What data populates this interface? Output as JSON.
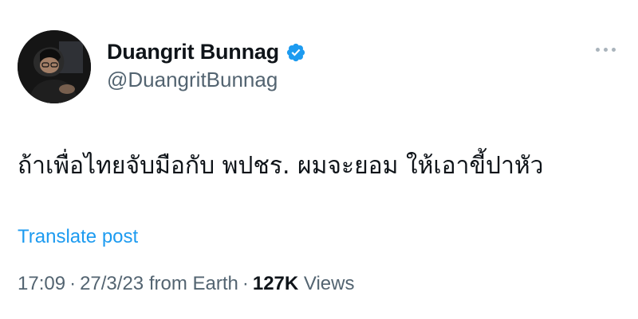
{
  "author": {
    "display_name": "Duangrit Bunnag",
    "handle": "@DuangritBunnag",
    "verified": true
  },
  "tweet": {
    "text": "ถ้าเพื่อไทยจับมือกับ พปชร. ผมจะยอม ให้เอาขี้ปาหัว",
    "translate_label": "Translate post",
    "time": "17:09",
    "date": "27/3/23",
    "source": "from Earth",
    "separator": "·",
    "views_count": "127K",
    "views_label": "Views"
  },
  "icons": {
    "verified": "verified-badge-icon",
    "more": "more-options-icon"
  },
  "colors": {
    "link": "#1d9bf0",
    "verified": "#1d9bf0",
    "secondary_text": "#536471",
    "primary_text": "#0f1419"
  }
}
